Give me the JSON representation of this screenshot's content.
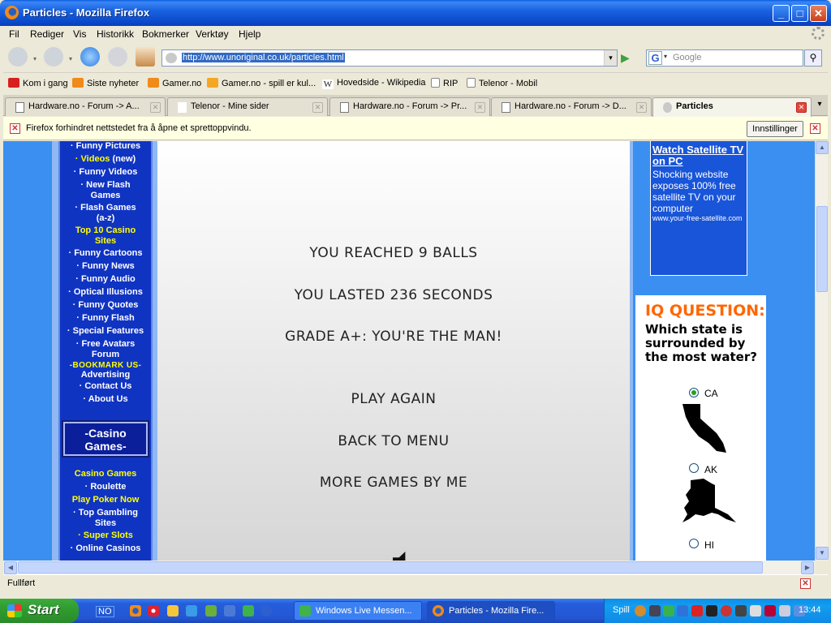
{
  "window": {
    "title": "Particles - Mozilla Firefox",
    "minimize": "_",
    "maximize": "□",
    "close": "✕"
  },
  "menu": [
    "Fil",
    "Rediger",
    "Vis",
    "Historikk",
    "Bokmerker",
    "Verktøy",
    "Hjelp"
  ],
  "nav": {
    "url": "http://www.unoriginal.co.uk/particles.html",
    "search_placeholder": "Google",
    "icons": [
      "back-icon",
      "forward-icon",
      "reload-icon",
      "stop-icon",
      "home-icon"
    ]
  },
  "bookmarks": [
    {
      "label": "Kom i gang",
      "icon": "firefox-bookmark-icon",
      "color": "#d81f1f"
    },
    {
      "label": "Siste nyheter",
      "icon": "rss-icon",
      "color": "#f08a1a"
    },
    {
      "label": "Gamer.no",
      "icon": "rss-icon",
      "color": "#f08a1a"
    },
    {
      "label": "Gamer.no - spill er kul...",
      "icon": "gamer-icon",
      "color": "#f5a623"
    },
    {
      "label": "Hovedside - Wikipedia",
      "icon": "wikipedia-icon",
      "color": "#444444"
    },
    {
      "label": "RIP",
      "icon": "page-icon",
      "color": "#ffffff"
    },
    {
      "label": "Telenor - Mobil",
      "icon": "page-icon",
      "color": "#ffffff"
    }
  ],
  "tabs": [
    {
      "label": "Hardware.no - Forum -> A...",
      "active": false
    },
    {
      "label": "Telenor - Mine sider",
      "active": false
    },
    {
      "label": "Hardware.no - Forum -> Pr...",
      "active": false
    },
    {
      "label": "Hardware.no - Forum -> D...",
      "active": false
    },
    {
      "label": "Particles",
      "active": true
    }
  ],
  "tab_close": "✕",
  "tab_list": "▾",
  "notification": {
    "message": "Firefox forhindret nettstedet fra å åpne et sprettoppvindu.",
    "button": "Innstillinger",
    "close": "✕"
  },
  "sidebar_links": [
    {
      "label": "Funny Pictures",
      "style": "w"
    },
    {
      "label": "Videos",
      "extra": " (new)",
      "style": "y"
    },
    {
      "label": "Funny Videos",
      "style": "w"
    },
    {
      "label": "New Flash Games",
      "style": "w"
    },
    {
      "label": "Flash Games (a-z)",
      "style": "w"
    },
    {
      "label": "Top 10 Casino Sites",
      "style": "y"
    },
    {
      "label": "Funny Cartoons",
      "style": "w"
    },
    {
      "label": "Funny News",
      "style": "w"
    },
    {
      "label": "Funny Audio",
      "style": "w"
    },
    {
      "label": "Optical Illusions",
      "style": "w"
    },
    {
      "label": "Funny Quotes",
      "style": "w"
    },
    {
      "label": "Funny Flash",
      "style": "w"
    },
    {
      "label": "Special Features",
      "style": "w"
    },
    {
      "label": "Free Avatars Forum",
      "style": "w"
    },
    {
      "label": "-BOOKMARK US-",
      "style": "y"
    },
    {
      "label": "Advertising",
      "style": "w"
    },
    {
      "label": "Contact Us",
      "style": "w"
    },
    {
      "label": "About Us",
      "style": "w"
    }
  ],
  "casino_box": "-Casino Games-",
  "casino_links": [
    {
      "label": "Casino Games",
      "style": "y"
    },
    {
      "label": "Roulette",
      "style": "w"
    },
    {
      "label": "Play Poker Now",
      "style": "y"
    },
    {
      "label": "Top Gambling Sites",
      "style": "w"
    },
    {
      "label": "Super Slots",
      "style": "y"
    },
    {
      "label": "Online Casinos",
      "style": "w"
    }
  ],
  "game": {
    "result1": "YOU REACHED 9 BALLS",
    "result2": "YOU LASTED 236 SECONDS",
    "grade": "GRADE A+: YOU'RE THE MAN!",
    "play_again": "PLAY AGAIN",
    "back_to_menu": "BACK TO MENU",
    "more_games": "MORE GAMES BY ME"
  },
  "ad": {
    "title": "Watch Satellite TV on PC",
    "body": "Shocking website exposes 100% free satellite TV on your computer",
    "url": "www.your-free-satellite.com"
  },
  "iq": {
    "heading": "IQ QUESTION:",
    "question": "Which state is surrounded by the most water?",
    "options": [
      {
        "label": "CA",
        "selected": true
      },
      {
        "label": "AK",
        "selected": false
      },
      {
        "label": "HI",
        "selected": false
      }
    ]
  },
  "status": "Fullført",
  "taskbar": {
    "start": "Start",
    "lang": "NO",
    "items": [
      {
        "label": "Windows Live Messen...",
        "active": false
      },
      {
        "label": "Particles - Mozilla Fire...",
        "active": true
      }
    ],
    "tray_label": "Spill",
    "clock": "13:44"
  }
}
